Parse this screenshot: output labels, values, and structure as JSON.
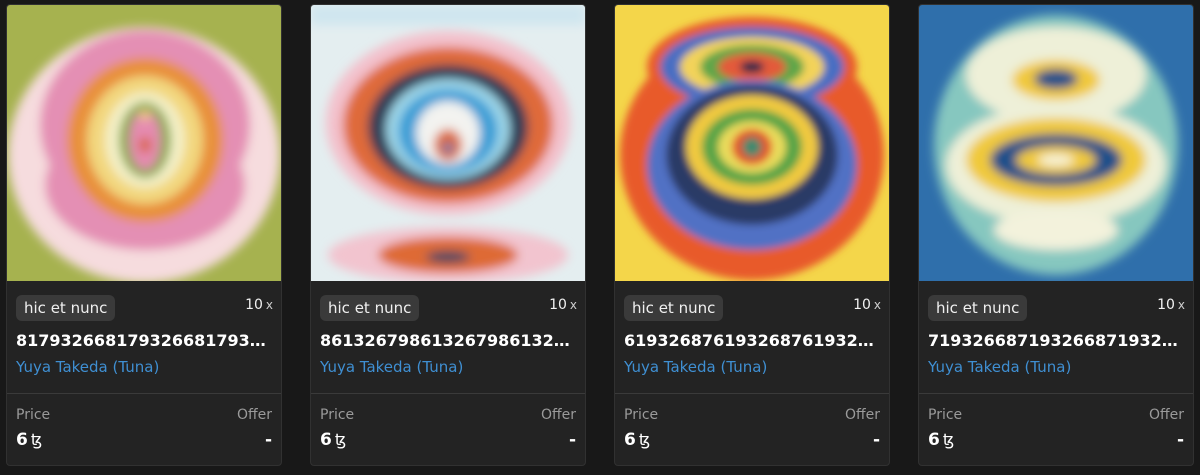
{
  "cards": [
    {
      "platform": "hic et nunc",
      "editions": "10",
      "editions_suffix": "x",
      "title": "8179326681793266817932...",
      "artist": "Yuya Takeda (Tuna)",
      "price_label": "Price",
      "offer_label": "Offer",
      "price": "6",
      "currency": "ꜩ",
      "offer": "-"
    },
    {
      "platform": "hic et nunc",
      "editions": "10",
      "editions_suffix": "x",
      "title": "8613267986132679861326...",
      "artist": "Yuya Takeda (Tuna)",
      "price_label": "Price",
      "offer_label": "Offer",
      "price": "6",
      "currency": "ꜩ",
      "offer": "-"
    },
    {
      "platform": "hic et nunc",
      "editions": "10",
      "editions_suffix": "x",
      "title": "6193268761932687619326...",
      "artist": "Yuya Takeda (Tuna)",
      "price_label": "Price",
      "offer_label": "Offer",
      "price": "6",
      "currency": "ꜩ",
      "offer": "-"
    },
    {
      "platform": "hic et nunc",
      "editions": "10",
      "editions_suffix": "x",
      "title": "7193266871932668719326...",
      "artist": "Yuya Takeda (Tuna)",
      "price_label": "Price",
      "offer_label": "Offer",
      "price": "6",
      "currency": "ꜩ",
      "offer": "-"
    }
  ],
  "colors": {
    "background": "#181818",
    "card": "#232323",
    "artist_link": "#3f8fd2"
  }
}
